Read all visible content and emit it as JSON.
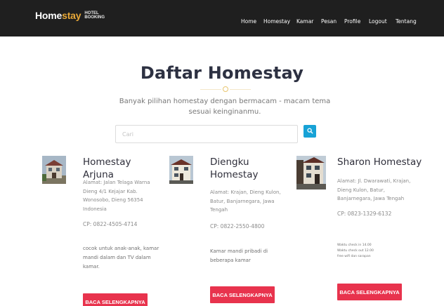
{
  "brand": {
    "name_white": "Home",
    "name_orange": "stay",
    "tag_top": "HOTEL",
    "tag_bottom": "BOOKING"
  },
  "nav": [
    {
      "label": "Home"
    },
    {
      "label": "Homestay"
    },
    {
      "label": "Kamar"
    },
    {
      "label": "Pesan"
    },
    {
      "label": "Profile"
    },
    {
      "label": "Logout"
    },
    {
      "label": "Tentang"
    }
  ],
  "page_title": "Daftar Homestay",
  "subtitle": "Banyak pilihan homestay dengan bermacam - macam tema sesuai keinginanmu.",
  "search": {
    "placeholder": "Cari",
    "value": ""
  },
  "homestays": [
    {
      "name": "Homestay Arjuna",
      "address": "Alamat: Jalan Telaga Warna Dieng 4/1 Kejajar Kab. Wonosobo, Dieng 56354 Indonesia",
      "phone": "CP: 0822-4505-4714",
      "description": "cocok untuk anak-anak, kamar mandi dalam dan TV dalam kamar.",
      "button": "BACA SELENGKAPNYA"
    },
    {
      "name": "Diengku Homestay",
      "address": "Alamat: Krajan, Dieng Kulon, Batur, Banjarnegara, Jawa Tengah",
      "phone": "CP: 0822-2550-4800",
      "description": "Kamar mandi pribadi di beberapa kamar",
      "button": "BACA SELENGKAPNYA"
    },
    {
      "name": "Sharon Homestay",
      "address": "Alamat: Jl. Dwarawati, Krajan, Dieng Kulon, Batur, Banjarnegara, Jawa Tengah",
      "phone": "CP: 0823-1329-6132",
      "description_lines": [
        "Waktu check in 14.00",
        "Waktu check out 12.00",
        "free wifi dan sarapan"
      ],
      "button": "BACA SELENGKAPNYA"
    }
  ],
  "colors": {
    "navbar": "#1f1f1f",
    "brand_accent": "#e8a838",
    "search_button": "#17a2d6",
    "read_button": "#e8334d"
  }
}
